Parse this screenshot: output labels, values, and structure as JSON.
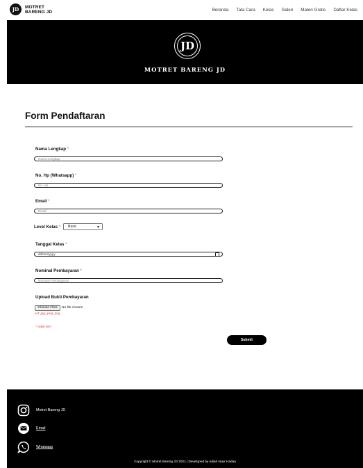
{
  "nav": {
    "brand_line1": "MOTRET",
    "brand_line2": "BARENG JD",
    "logo_text": "JD",
    "items": [
      "Beranda",
      "Tata Cara",
      "Kelas",
      "Galeri",
      "Materi Gratis",
      "Daftar Kelas"
    ]
  },
  "hero": {
    "logo_text": "JD",
    "title": "MOTRET BARENG JD"
  },
  "form": {
    "title": "Form Pendaftaran",
    "name_label": "Nama Lengkap",
    "name_placeholder": "Nama Lengkap",
    "phone_label": "No. Hp (Whatsapp)",
    "phone_placeholder": "No. Hp",
    "email_label": "Email",
    "email_placeholder": "Email",
    "level_label": "Level Kelas",
    "level_value": "Basic",
    "date_label": "Tanggal Kelas",
    "date_placeholder": "dd/mm/yyyy",
    "payment_label": "Nominal Pembayaran",
    "payment_placeholder": "Nominal Pembayaran",
    "upload_label": "Upload Bukti Pembayaran",
    "choose_file": "Choose Files",
    "no_file": "No file chosen",
    "ext_note": "ext: jpg, jpeg, png",
    "required_mark": "*",
    "required_note": "* wajib diisi",
    "submit_label": "Submit"
  },
  "footer": {
    "instagram": "Motret Bareng JD",
    "email": "Email",
    "whatsapp": "Whatsapp",
    "copyright": "Copyright © Motret Bareng JD 2021 | Developed by Adiah Nuur Hadaa"
  },
  "icons": {
    "instagram": "instagram-icon",
    "email": "mail-icon",
    "whatsapp": "whatsapp-icon",
    "calendar": "calendar-icon",
    "dropdown": "chevron-down-icon"
  },
  "colors": {
    "dark": "#000000",
    "required": "#e04040"
  }
}
